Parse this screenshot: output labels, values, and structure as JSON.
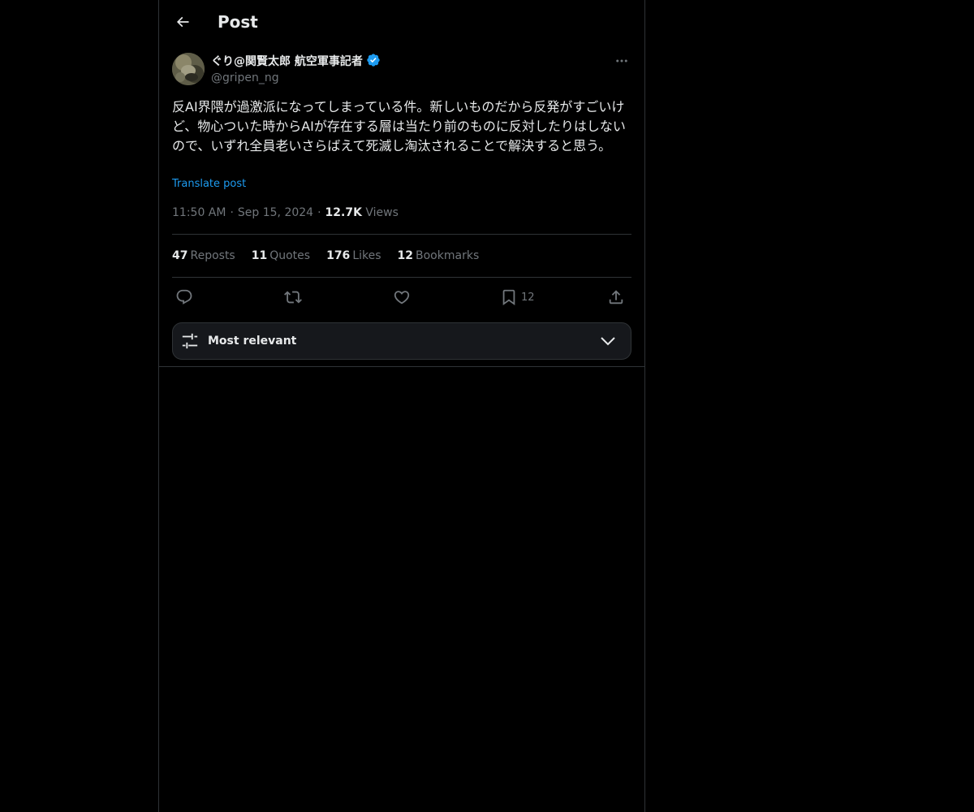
{
  "header": {
    "title": "Post",
    "back_icon": "arrow-left-icon"
  },
  "author": {
    "display_name": "ぐり@関賢太郎 航空軍事記者",
    "handle": "@gripen_ng",
    "verified": true,
    "verified_color": "#1d9bf0"
  },
  "post": {
    "text": "反AI界隈が過激派になってしまっている件。新しいものだから反発がすごいけど、物心ついた時からAIが存在する層は当たり前のものに反対したりはしないので、いずれ全員老いさらばえて死滅し淘汰されることで解決すると思う。",
    "translate_label": "Translate post",
    "time": "11:50 AM",
    "date": "Sep 15, 2024",
    "views_count": "12.7K",
    "views_label": "Views"
  },
  "stats": {
    "reposts_count": "47",
    "reposts_label": "Reposts",
    "quotes_count": "11",
    "quotes_label": "Quotes",
    "likes_count": "176",
    "likes_label": "Likes",
    "bookmarks_count": "12",
    "bookmarks_label": "Bookmarks"
  },
  "actions": {
    "reply_icon": "reply-icon",
    "repost_icon": "repost-icon",
    "like_icon": "heart-icon",
    "bookmark_icon": "bookmark-icon",
    "bookmark_count": "12",
    "share_icon": "share-icon"
  },
  "sort": {
    "label": "Most relevant",
    "icon": "sliders-icon",
    "chevron": "chevron-down-icon"
  },
  "colors": {
    "background": "#000000",
    "text": "#e7e9ea",
    "muted": "#71767b",
    "accent": "#1d9bf0",
    "border": "#2f3336"
  }
}
